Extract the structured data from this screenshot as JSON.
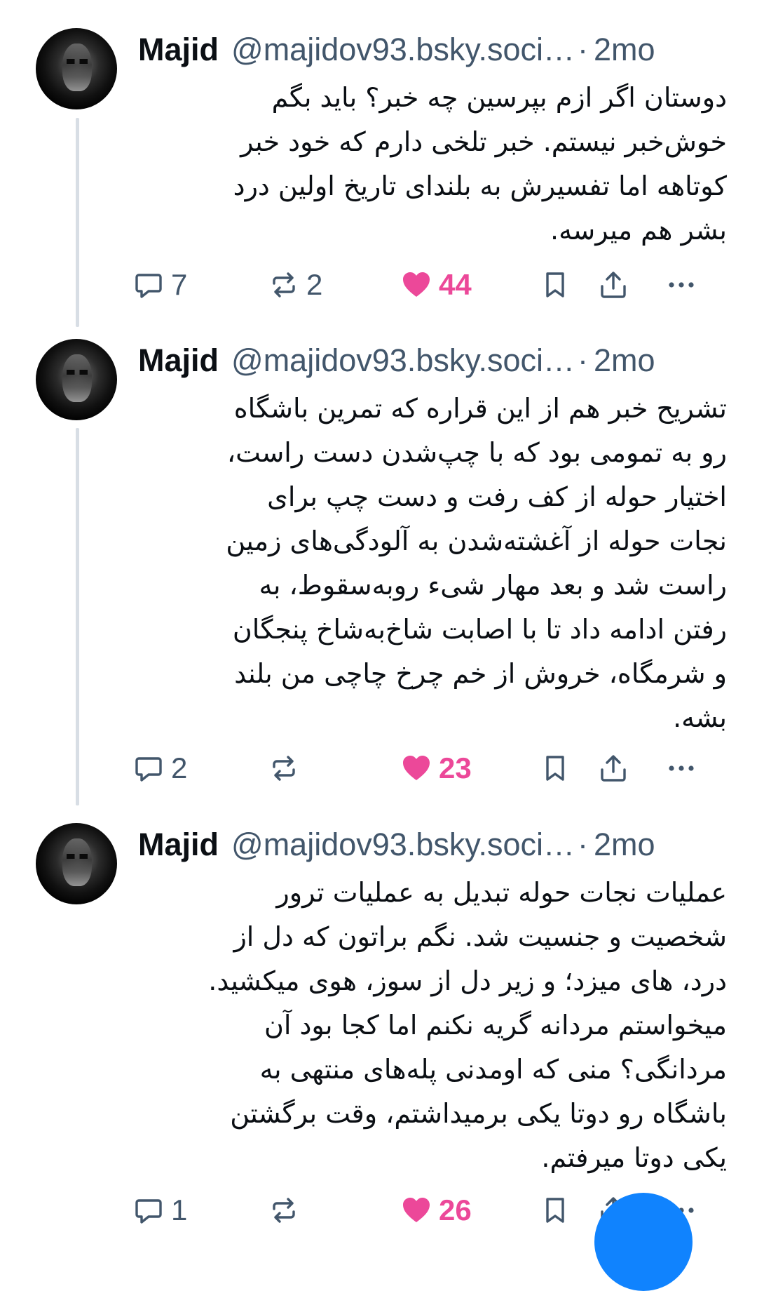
{
  "posts": [
    {
      "author": "Majid",
      "handle": "@majidov93.bsky.soci…",
      "dot": "·",
      "time": "2mo",
      "lines": [
        "دوستان اگر ازم بپرسین چه خبر؟ باید بگم",
        "خوش‌خبر نیستم. خبر تلخی دارم که خود خبر",
        "کوتاهه اما تفسیرش به بلندای تاریخ اولین درد",
        "بشر هم میرسه."
      ],
      "replies": "7",
      "reposts": "2",
      "likes": "44",
      "liked": true
    },
    {
      "author": "Majid",
      "handle": "@majidov93.bsky.soci…",
      "dot": "·",
      "time": "2mo",
      "lines": [
        "تشریح خبر هم از این قراره که تمرین باشگاه",
        "رو به تمومی بود که با چپ‌شدن دست راست،",
        "اختیار حوله از کف رفت و دست چپ برای",
        "نجات حوله از آغشته‌شدن به آلودگی‌های زمین",
        "راست شد و بعد مهار شیء روبه‌سقوط، به",
        "رفتن ادامه داد تا با اصابت شاخ‌به‌شاخ پنجگان",
        "و شرمگاه، خروش از خم چرخ چاچی من بلند",
        "بشه."
      ],
      "replies": "2",
      "reposts": "",
      "likes": "23",
      "liked": true
    },
    {
      "author": "Majid",
      "handle": "@majidov93.bsky.soci…",
      "dot": "·",
      "time": "2mo",
      "lines": [
        "عملیات نجات حوله تبدیل به عملیات ترور",
        "شخصیت و جنسیت شد. نگم براتون که دل از",
        "درد، های میزد؛ و زیر دل از سوز، هوی میکشید.",
        "میخواستم مردانه گریه نکنم اما کجا بود آن",
        "مردانگی؟ منی که اومدنی پله‌های منتهی به",
        "باشگاه رو دوتا یکی برمیداشتم، وقت برگشتن",
        "یکی دوتا میرفتم."
      ],
      "replies": "1",
      "reposts": "",
      "likes": "26",
      "liked": true
    }
  ],
  "icons": {
    "reply": "reply-icon",
    "repost": "repost-icon",
    "like": "heart-icon",
    "bookmark": "bookmark-icon",
    "share": "share-icon",
    "more": "more-icon"
  },
  "colors": {
    "text": "#0b0f14",
    "muted": "#42566b",
    "like": "#ec4899",
    "thread": "#d8dee5",
    "fab": "#1083fe"
  }
}
